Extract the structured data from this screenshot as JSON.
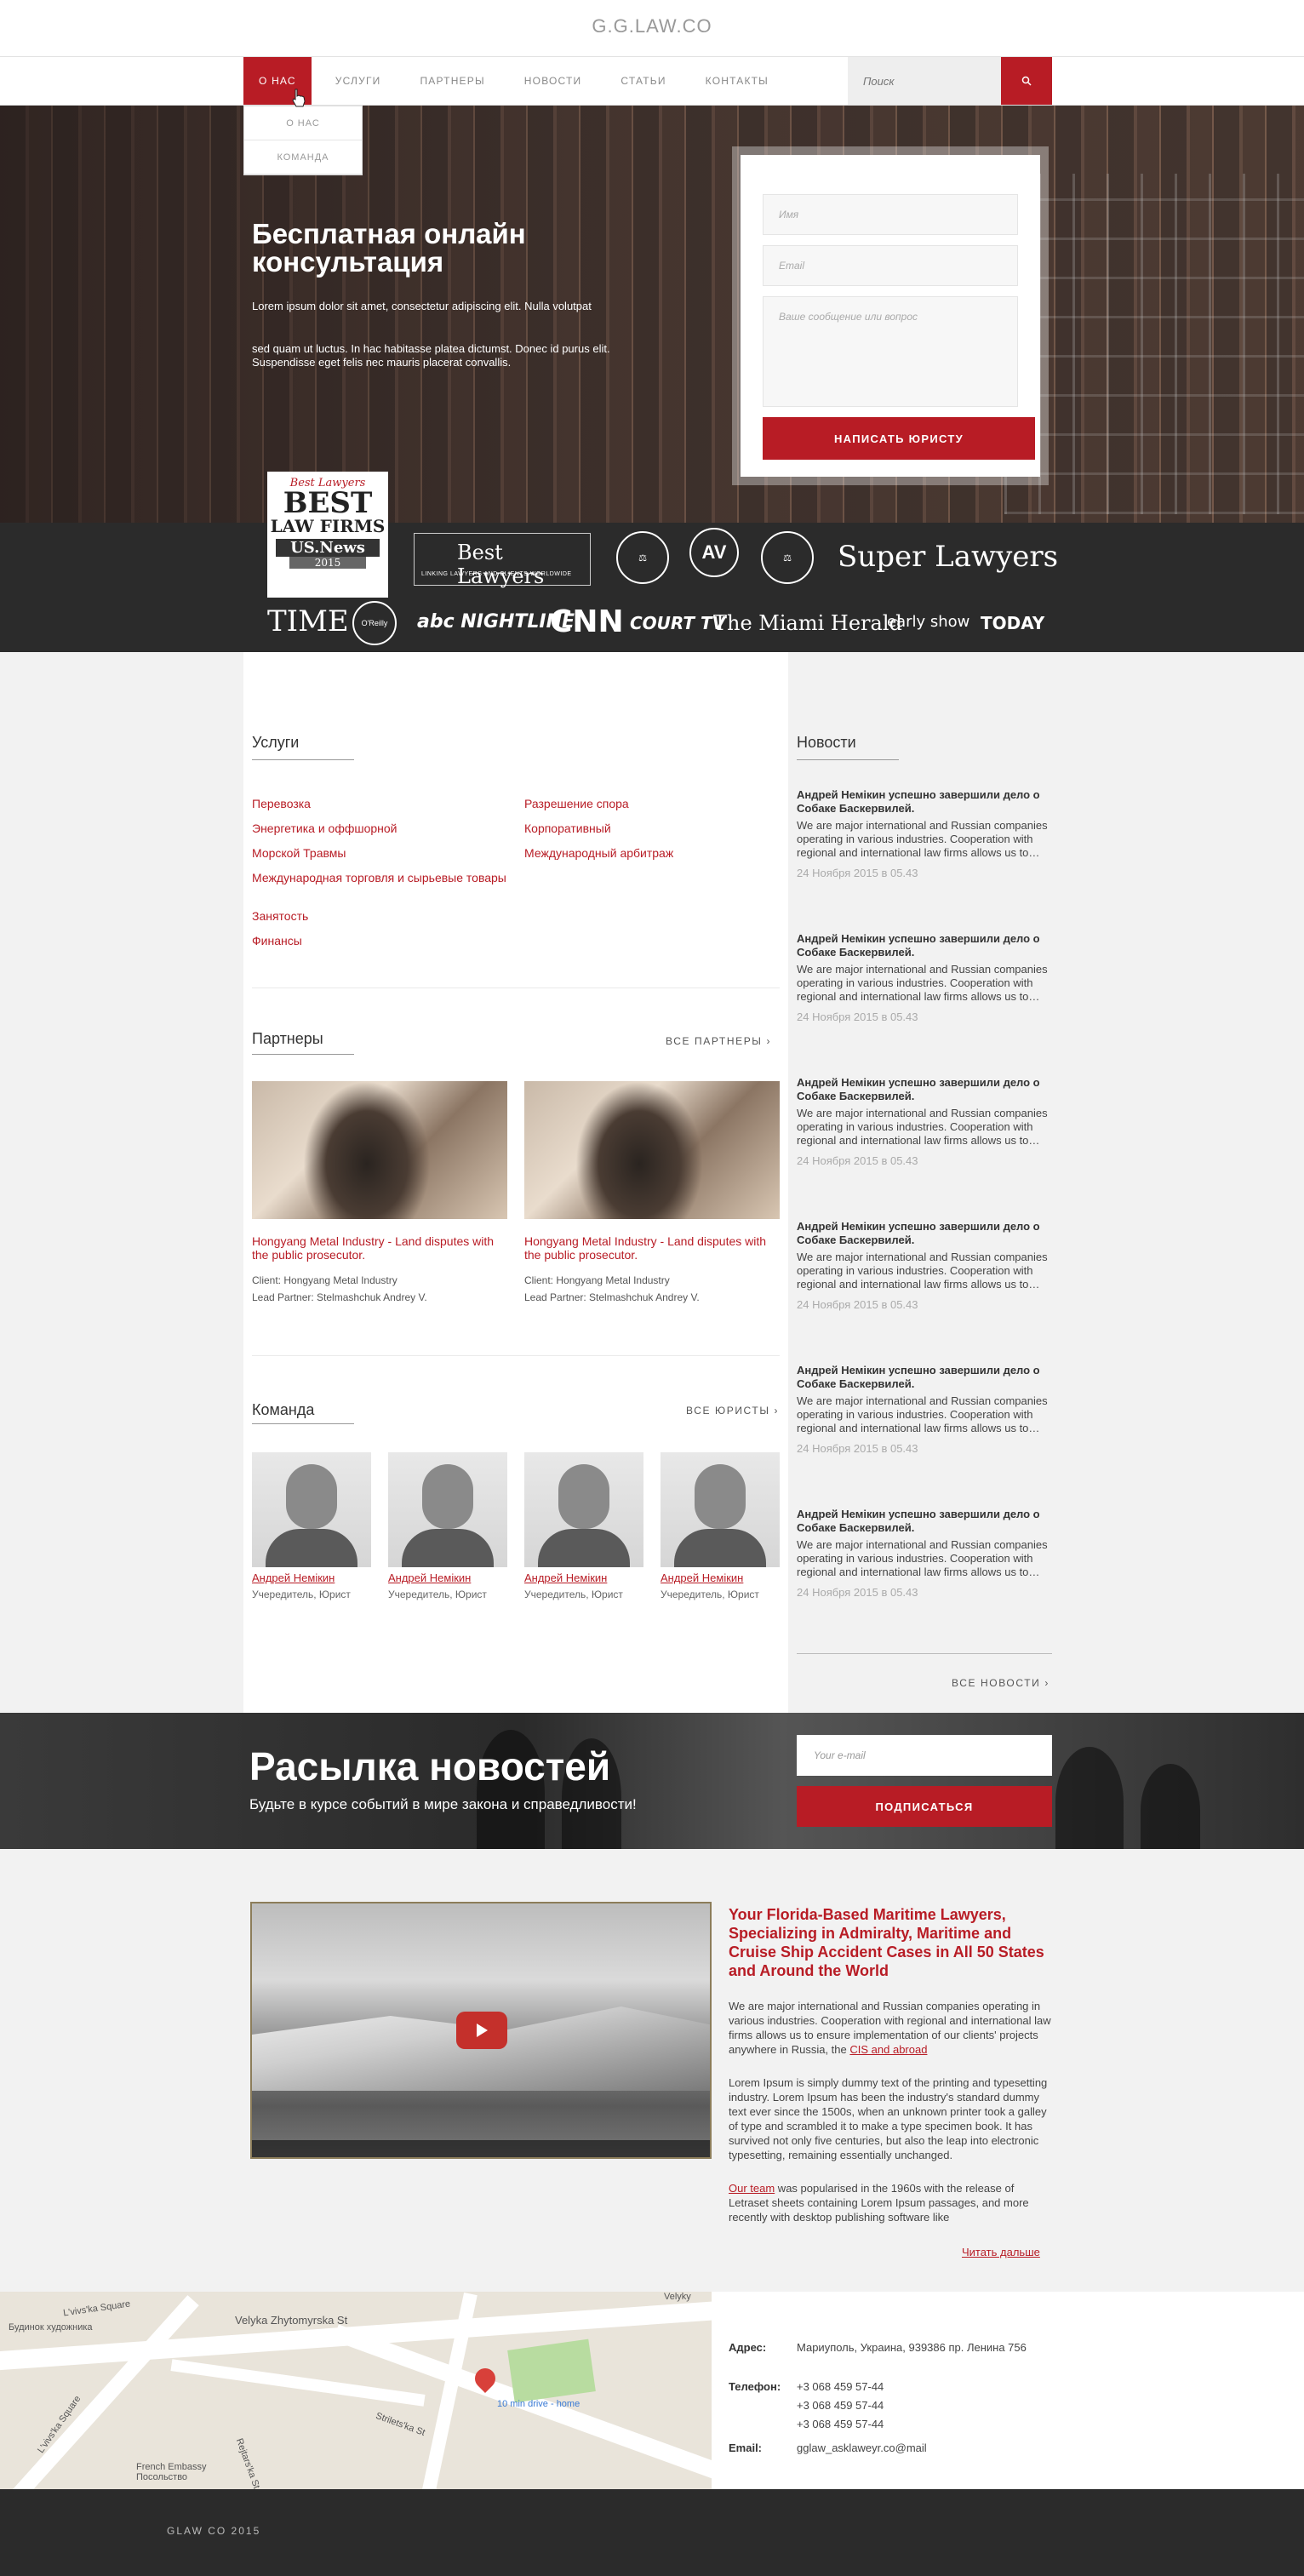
{
  "brand": "G.G.LAW.CO",
  "nav": {
    "items": [
      "О нас",
      "Услуги",
      "Партнеры",
      "Новости",
      "Статьи",
      "Контакты"
    ],
    "search_placeholder": "Поиск",
    "dropdown": [
      "О нас",
      "Команда"
    ]
  },
  "hero": {
    "title": "Бесплатная онлайн консультация",
    "p1": "Lorem ipsum dolor sit amet, consectetur adipiscing elit. Nulla volutpat",
    "p2": "sed quam ut luctus. In hac habitasse platea dictumst. Donec id purus elit. Suspendisse eget felis nec mauris placerat convallis.",
    "form": {
      "name_placeholder": "Имя",
      "email_placeholder": "Email",
      "message_placeholder": "Ваше сообщение или вопрос",
      "submit": "Написать юристу"
    }
  },
  "logos": {
    "best_lawyers_badge": [
      "Best Lawyers",
      "BEST",
      "LAW FIRMS",
      "US.News",
      "2015"
    ],
    "best_lawyers": "Best Lawyers",
    "best_lawyers_sub": "LINKING LAWYERS AND CLIENTS WORLDWIDE",
    "av": "AV",
    "super_lawyers": "Super Lawyers",
    "media": [
      "TIME",
      "O'Reilly",
      "abc NIGHTLINE",
      "CNN",
      "COURT TV",
      "The Miami Herald",
      "early show",
      "TODAY"
    ]
  },
  "services": {
    "title": "Услуги",
    "col1": [
      "Перевозка",
      "Энергетика и оффшорной",
      "Морской Травмы",
      "Международная торговля и сырьевые товары",
      "Занятость",
      "Финансы"
    ],
    "col2": [
      "Разрешение спора",
      "Корпоративный",
      "Международный арбитраж"
    ]
  },
  "partners": {
    "title": "Партнеры",
    "all": "Все партнеры",
    "cards": [
      {
        "title": "Hongyang Metal Industry - Land disputes with the public prosecutor.",
        "client": "Client: Hongyang Metal Industry",
        "lead": "Lead Partner: Stelmashchuk Andrey V."
      },
      {
        "title": "Hongyang Metal Industry - Land disputes with the public prosecutor.",
        "client": "Client: Hongyang Metal Industry",
        "lead": "Lead Partner: Stelmashchuk Andrey V."
      }
    ]
  },
  "team": {
    "title": "Команда",
    "all": "Все юристы",
    "members": [
      {
        "name": "Андрей Немікин",
        "role": "Учередитель, Юрист"
      },
      {
        "name": "Андрей Немікин",
        "role": "Учередитель, Юрист"
      },
      {
        "name": "Андрей Немікин",
        "role": "Учередитель, Юрист"
      },
      {
        "name": "Андрей Немікин",
        "role": "Учередитель, Юрист"
      }
    ]
  },
  "news": {
    "title": "Новости",
    "all": "Все новости",
    "items": [
      {
        "title": "Андрей Немікин успешно завершили дело о Собаке Баскервилей.",
        "body": "We are major international and Russian companies operating in various industries. Cooperation with regional and international law firms allows us to…",
        "date": "24 Ноября 2015 в 05.43"
      },
      {
        "title": "Андрей Немікин успешно завершили дело о Собаке Баскервилей.",
        "body": "We are major international and Russian companies operating in various industries. Cooperation with regional and international law firms allows us to…",
        "date": "24 Ноября 2015 в 05.43"
      },
      {
        "title": "Андрей Немікин успешно завершили дело о Собаке Баскервилей.",
        "body": "We are major international and Russian companies operating in various industries. Cooperation with regional and international law firms allows us to…",
        "date": "24 Ноября 2015 в 05.43"
      },
      {
        "title": "Андрей Немікин успешно завершили дело о Собаке Баскервилей.",
        "body": "We are major international and Russian companies operating in various industries. Cooperation with regional and international law firms allows us to…",
        "date": "24 Ноября 2015 в 05.43"
      },
      {
        "title": "Андрей Немікин успешно завершили дело о Собаке Баскервилей.",
        "body": "We are major international and Russian companies operating in various industries. Cooperation with regional and international law firms allows us to…",
        "date": "24 Ноября 2015 в 05.43"
      },
      {
        "title": "Андрей Немікин успешно завершили дело о Собаке Баскервилей.",
        "body": "We are major international and Russian companies operating in various industries. Cooperation with regional and international law firms allows us to…",
        "date": "24 Ноября 2015 в 05.43"
      }
    ]
  },
  "subscribe": {
    "title": "Расылка новостей",
    "subtitle": "Будьте в курсе событий в мире закона и справедливости!",
    "placeholder": "Your e-mail",
    "button": "Подписаться"
  },
  "about": {
    "heading": "Your Florida-Based Maritime Lawyers, Specializing in Admiralty, Maritime and Cruise Ship Accident Cases in All 50 States and Around the World",
    "p1": "We are major international and Russian companies operating in various industries. Cooperation with regional and international law firms allows us to ensure implementation of our clients' projects anywhere in Russia, the",
    "p1_link": "CIS and abroad",
    "p2": "Lorem Ipsum is simply dummy text of the printing and typesetting industry. Lorem Ipsum has been the industry's standard dummy text ever since the 1500s, when an unknown printer took a galley of type and scrambled it to make a type specimen book. It has survived not only five centuries, but also the leap into electronic typesetting, remaining essentially unchanged.",
    "p3_link": "Our team",
    "p3": " was popularised in the 1960s with the release of Letraset sheets containing Lorem Ipsum passages, and more recently with desktop publishing software like",
    "read_more": "Читать дальше"
  },
  "map": {
    "labels": [
      "L'vivs'ka Square",
      "Velyka Zhytomyrska St",
      "Будинок художника",
      "Strilets'ka St",
      "Rejtars'ka St",
      "L'vivs'ka Square",
      "French Embassy Посольство",
      "Velyky"
    ],
    "pin_label": "10 min drive - home"
  },
  "contacts": {
    "address_label": "Адрес:",
    "address": "Мариуполь, Украина, 939386 пр. Ленина 756",
    "phone_label": "Телефон:",
    "phones": [
      "+3 068 459 57-44",
      "+3 068 459 57-44",
      "+3 068 459 57-44"
    ],
    "email_label": "Email:",
    "email": "gglaw_asklaweyr.co@mail"
  },
  "footer": "GLAW CO 2015"
}
